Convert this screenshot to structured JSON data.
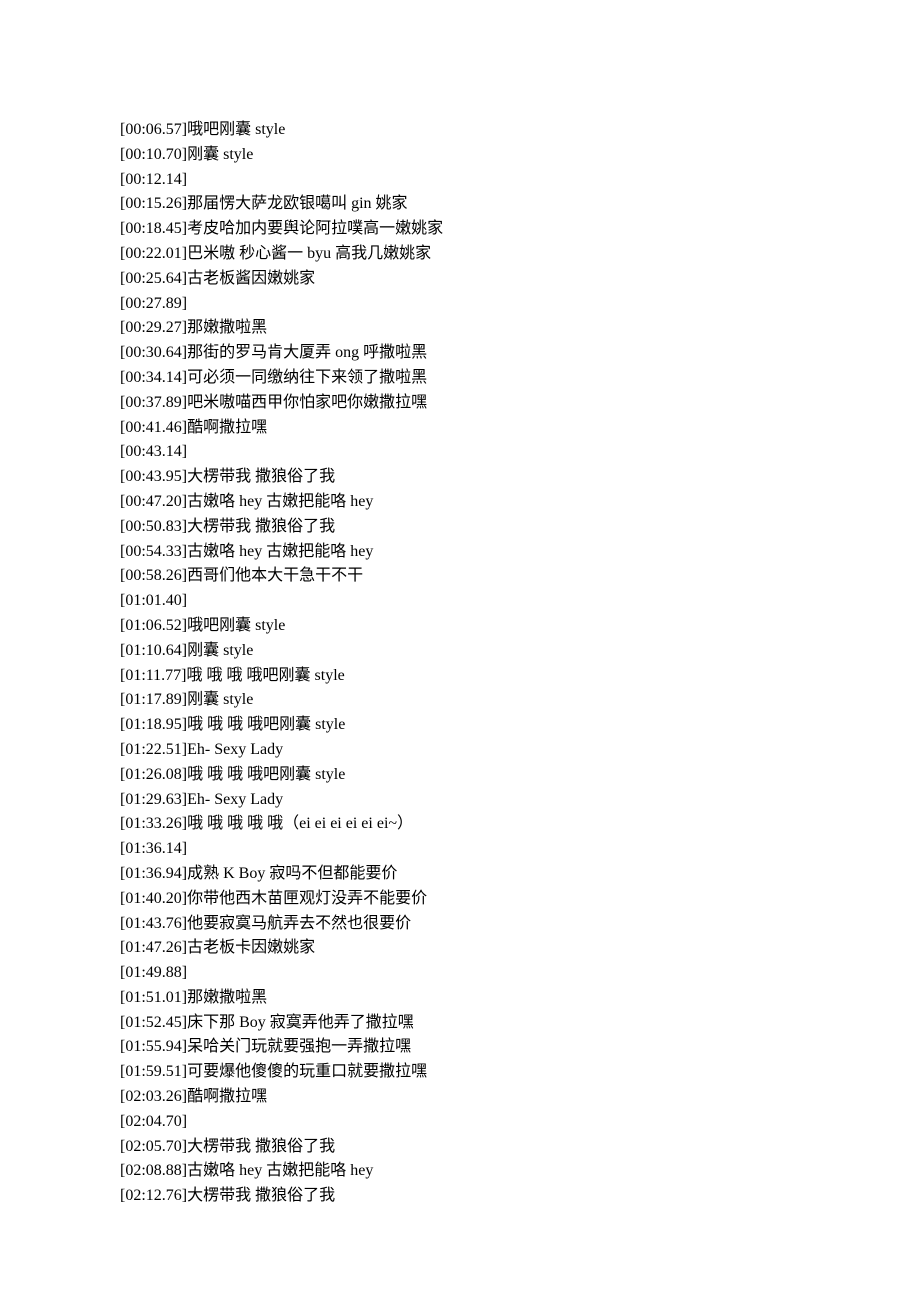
{
  "lyrics": [
    {
      "timestamp": "[00:06.57]",
      "text": "哦吧刚囊 style"
    },
    {
      "timestamp": "[00:10.70]",
      "text": "刚囊 style"
    },
    {
      "timestamp": "[00:12.14]",
      "text": ""
    },
    {
      "timestamp": "[00:15.26]",
      "text": "那届愣大萨龙欧银噶叫 gin 姚家"
    },
    {
      "timestamp": "[00:18.45]",
      "text": "考皮哈加内要舆论阿拉噗高一嫩姚家"
    },
    {
      "timestamp": "[00:22.01]",
      "text": "巴米嗷  秒心酱一 byu 高我几嫩姚家"
    },
    {
      "timestamp": "[00:25.64]",
      "text": "古老板酱因嫩姚家"
    },
    {
      "timestamp": "[00:27.89]",
      "text": ""
    },
    {
      "timestamp": "[00:29.27]",
      "text": "那嫩撒啦黑"
    },
    {
      "timestamp": "[00:30.64]",
      "text": "那街的罗马肯大厦弄 ong  呼撒啦黑"
    },
    {
      "timestamp": "[00:34.14]",
      "text": "可必须一同缴纳往下来领了撒啦黑"
    },
    {
      "timestamp": "[00:37.89]",
      "text": "吧米嗷喵西甲你怕家吧你嫩撒拉嘿"
    },
    {
      "timestamp": "[00:41.46]",
      "text": "酷啊撒拉嘿"
    },
    {
      "timestamp": "[00:43.14]",
      "text": ""
    },
    {
      "timestamp": "[00:43.95]",
      "text": "大楞带我 撒狼俗了我"
    },
    {
      "timestamp": "[00:47.20]",
      "text": "古嫩咯 hey  古嫩把能咯 hey"
    },
    {
      "timestamp": "[00:50.83]",
      "text": "大楞带我  撒狼俗了我"
    },
    {
      "timestamp": "[00:54.33]",
      "text": "古嫩咯 hey  古嫩把能咯 hey"
    },
    {
      "timestamp": "[00:58.26]",
      "text": "西哥们他本大干急干不干"
    },
    {
      "timestamp": "[01:01.40]",
      "text": ""
    },
    {
      "timestamp": "[01:06.52]",
      "text": "哦吧刚囊 style"
    },
    {
      "timestamp": "[01:10.64]",
      "text": "刚囊 style"
    },
    {
      "timestamp": "[01:11.77]",
      "text": "哦  哦  哦  哦吧刚囊 style"
    },
    {
      "timestamp": "[01:17.89]",
      "text": "刚囊 style"
    },
    {
      "timestamp": "[01:18.95]",
      "text": "哦  哦  哦  哦吧刚囊 style"
    },
    {
      "timestamp": "[01:22.51]",
      "text": "Eh- Sexy Lady"
    },
    {
      "timestamp": "[01:26.08]",
      "text": "哦  哦  哦  哦吧刚囊 style"
    },
    {
      "timestamp": "[01:29.63]",
      "text": "Eh- Sexy Lady"
    },
    {
      "timestamp": "[01:33.26]",
      "text": "哦 哦 哦 哦 哦（ei ei ei ei ei ei~）"
    },
    {
      "timestamp": "[01:36.14]",
      "text": ""
    },
    {
      "timestamp": "[01:36.94]",
      "text": "成熟 K Boy 寂吗不但都能要价"
    },
    {
      "timestamp": "[01:40.20]",
      "text": "你带他西木苗匣观灯没弄不能要价"
    },
    {
      "timestamp": "[01:43.76]",
      "text": "他要寂寞马航弄去不然也很要价"
    },
    {
      "timestamp": "[01:47.26]",
      "text": "古老板卡因嫩姚家"
    },
    {
      "timestamp": "[01:49.88]",
      "text": ""
    },
    {
      "timestamp": "[01:51.01]",
      "text": "那嫩撒啦黑"
    },
    {
      "timestamp": "[01:52.45]",
      "text": "床下那 Boy 寂寞弄他弄了撒拉嘿"
    },
    {
      "timestamp": "[01:55.94]",
      "text": "呆哈关门玩就要强抱一弄撒拉嘿"
    },
    {
      "timestamp": "[01:59.51]",
      "text": "可要爆他傻傻的玩重口就要撒拉嘿"
    },
    {
      "timestamp": "[02:03.26]",
      "text": "酷啊撒拉嘿"
    },
    {
      "timestamp": "[02:04.70]",
      "text": ""
    },
    {
      "timestamp": "[02:05.70]",
      "text": "大楞带我  撒狼俗了我"
    },
    {
      "timestamp": "[02:08.88]",
      "text": "古嫩咯 hey  古嫩把能咯 hey"
    },
    {
      "timestamp": "[02:12.76]",
      "text": "大楞带我  撒狼俗了我"
    }
  ]
}
